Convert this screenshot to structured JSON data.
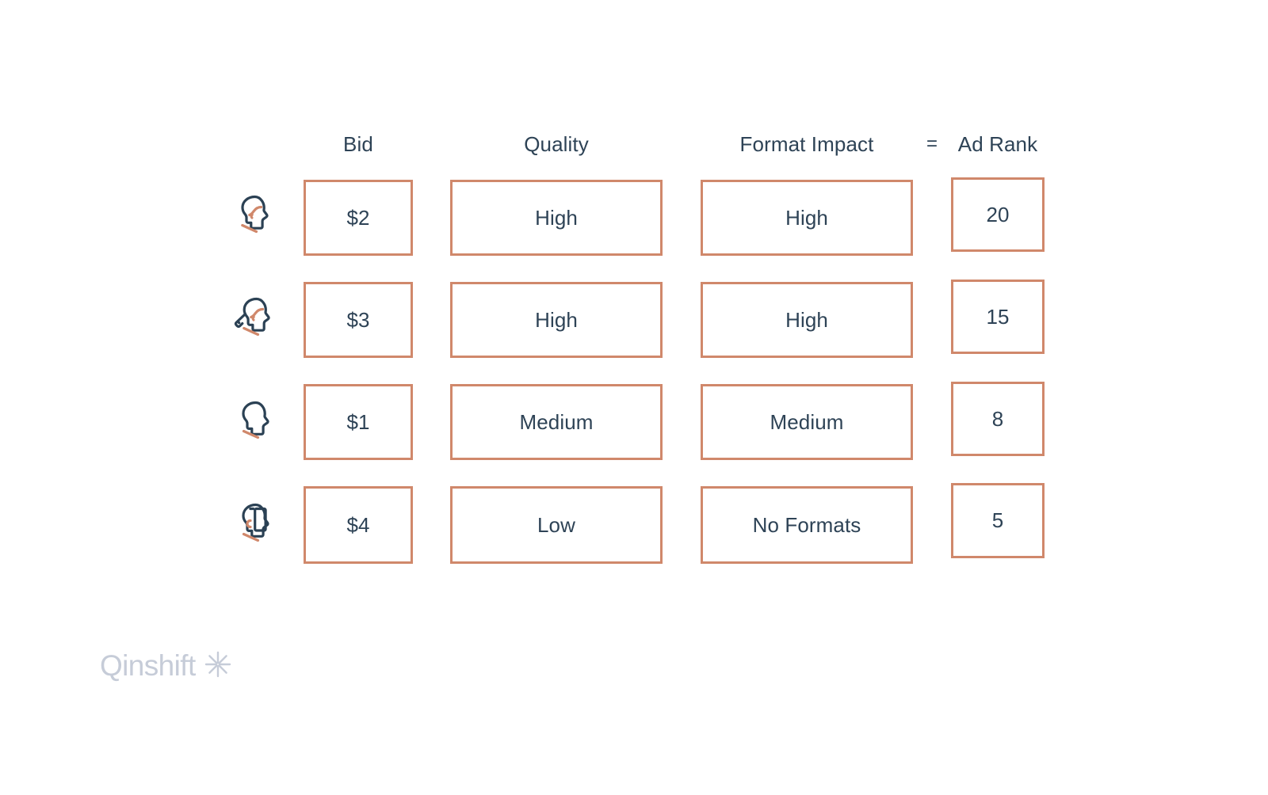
{
  "table": {
    "columns": [
      {
        "key": "bid",
        "label": "Bid"
      },
      {
        "key": "quality",
        "label": "Quality"
      },
      {
        "key": "format",
        "label": "Format Impact"
      },
      {
        "key": "equals",
        "label": "="
      },
      {
        "key": "adrank",
        "label": "Ad Rank"
      }
    ],
    "rows": [
      {
        "avatar": "person-head-profile-icon",
        "bid": "$2",
        "quality": "High",
        "format": "High",
        "adrank": "20"
      },
      {
        "avatar": "person-head-profile-pointer-icon",
        "bid": "$3",
        "quality": "High",
        "format": "High",
        "adrank": "15"
      },
      {
        "avatar": "person-head-outline-icon",
        "bid": "$1",
        "quality": "Medium",
        "format": "Medium",
        "adrank": "8"
      },
      {
        "avatar": "person-head-bracket-icon",
        "bid": "$4",
        "quality": "Low",
        "format": "No Formats",
        "adrank": "5"
      }
    ]
  },
  "brand": {
    "name": "Qinshift",
    "mark": "starburst-icon"
  },
  "colors": {
    "border": "#d0886b",
    "text": "#2e4356",
    "icon_dark": "#2b4154",
    "icon_accent": "#d0886b",
    "brand": "#c6ccd8",
    "background": "#ffffff"
  }
}
